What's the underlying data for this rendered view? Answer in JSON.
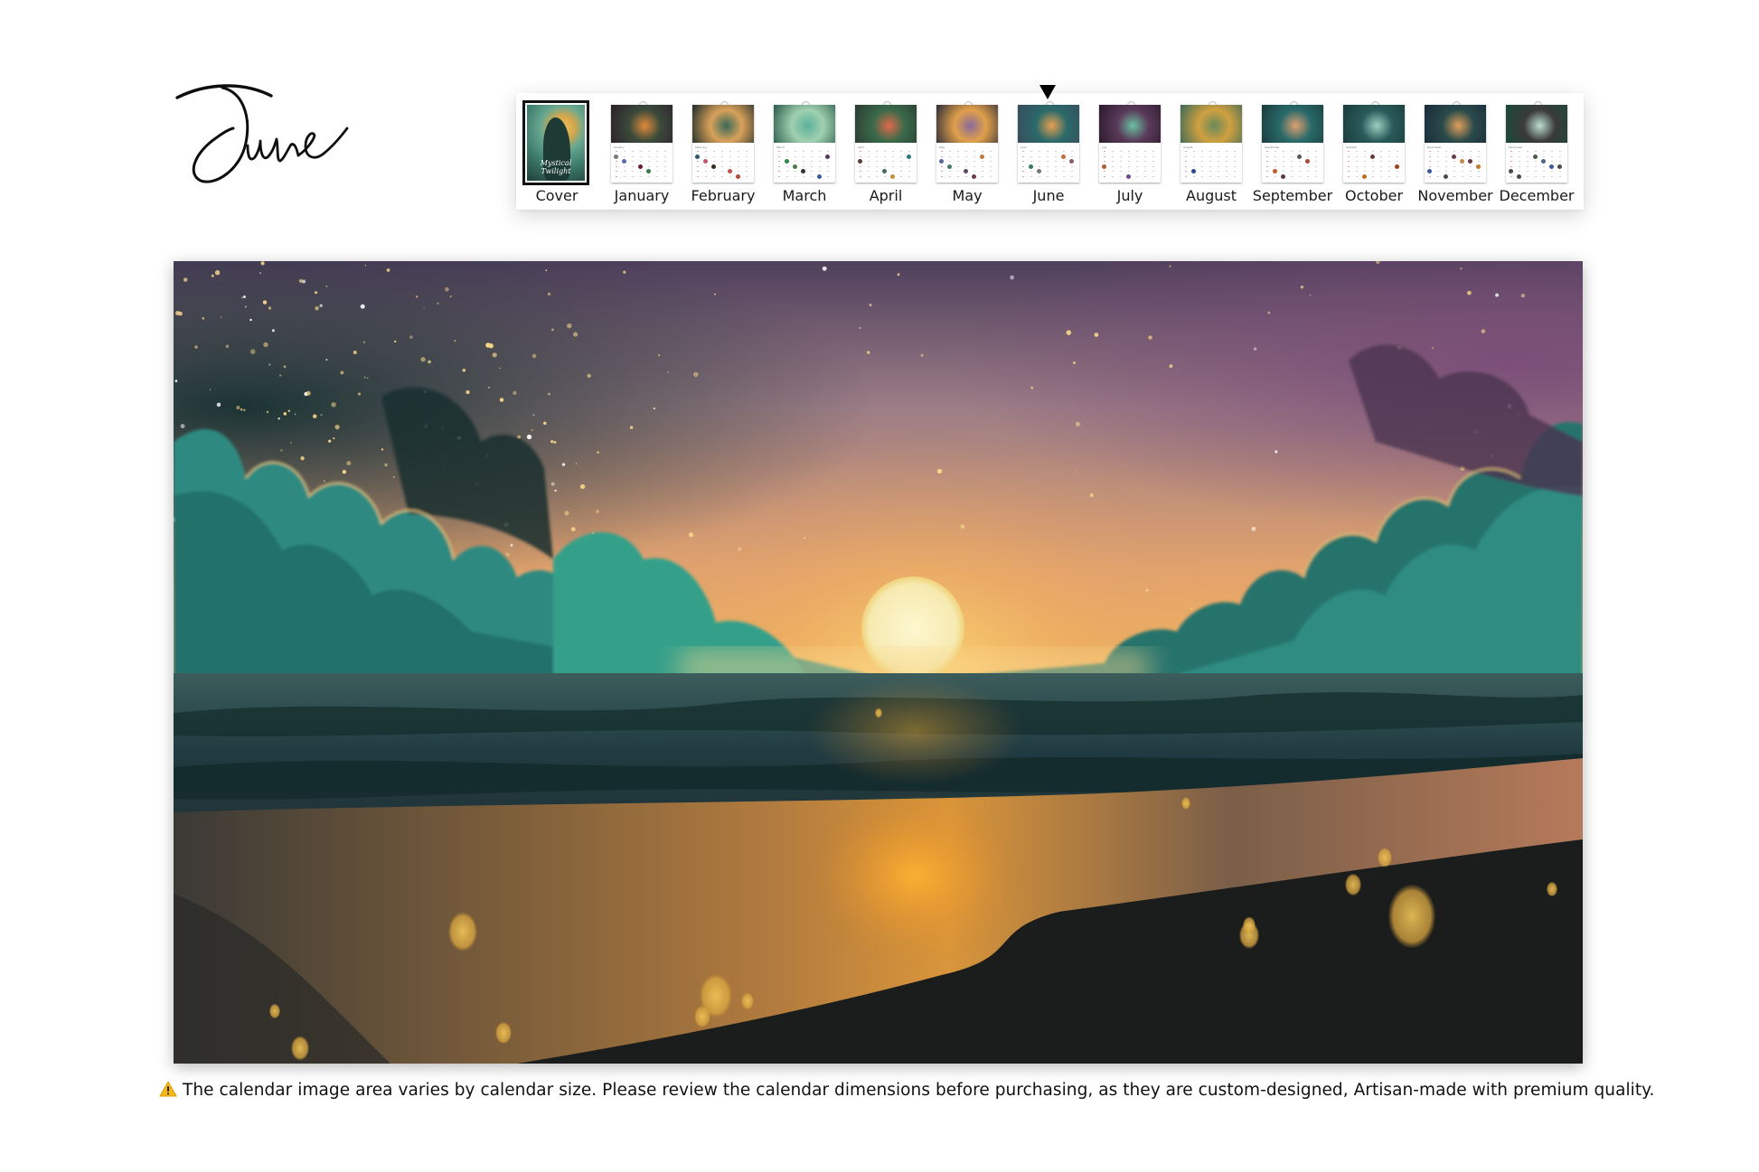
{
  "page": {
    "month_title": "June",
    "selected_month": "June"
  },
  "strip": {
    "items": [
      {
        "label": "Cover",
        "kind": "cover",
        "cover_text": "Mystical Twilight"
      },
      {
        "label": "January",
        "kind": "month",
        "colors": [
          "#2a1f2a",
          "#e08a3a",
          "#3b4a3a"
        ],
        "dots": [
          "#5a6ab0",
          "#3b7b4a",
          "#777777",
          "#6a1a3a"
        ]
      },
      {
        "label": "February",
        "kind": "month",
        "colors": [
          "#1b2a2a",
          "#3a6a5a",
          "#d9a15a"
        ],
        "dots": [
          "#3a2a1a",
          "#b04a3a",
          "#c05a6a",
          "#c0504a",
          "#2a5a6a"
        ]
      },
      {
        "label": "March",
        "kind": "month",
        "colors": [
          "#2a5a4a",
          "#5ab09a",
          "#a0d0b0"
        ],
        "dots": [
          "#333333",
          "#5a3a5a",
          "#4a7a4a",
          "#3a5aa0",
          "#2a8a4a"
        ]
      },
      {
        "label": "April",
        "kind": "month",
        "colors": [
          "#2a3a30",
          "#e06a4a",
          "#3a6a4a"
        ],
        "dots": [
          "#c0903a",
          "#5a3a3a",
          "#4a6a5a",
          "#2a7a7a"
        ]
      },
      {
        "label": "May",
        "kind": "month",
        "colors": [
          "#2a2a3a",
          "#8a6a9a",
          "#e0a04a"
        ],
        "dots": [
          "#c07a3a",
          "#4a7a5a",
          "#6a3a4a",
          "#5a6aa0",
          "#5a4a6a"
        ]
      },
      {
        "label": "June",
        "kind": "month",
        "colors": [
          "#3a4a5a",
          "#e8a050",
          "#2a6a6a"
        ],
        "dots": [
          "#8a5a6a",
          "#777777",
          "#c0703a",
          "#3a7a6a"
        ]
      },
      {
        "label": "July",
        "kind": "month",
        "colors": [
          "#2a1a2a",
          "#6ac0a0",
          "#5a3a5a"
        ],
        "dots": [
          "#b05a3a",
          "#6a4a8a"
        ]
      },
      {
        "label": "August",
        "kind": "month",
        "colors": [
          "#3a6a5a",
          "#6a8a5a",
          "#d0a040"
        ],
        "dots": [
          "#2a4a8a"
        ]
      },
      {
        "label": "September",
        "kind": "month",
        "colors": [
          "#1a3a3a",
          "#e0a070",
          "#2a6a6a"
        ],
        "dots": [
          "#5a3a4a",
          "#b04a3a",
          "#c05a2a",
          "#5a5a5a"
        ]
      },
      {
        "label": "October",
        "kind": "month",
        "colors": [
          "#1a3a3a",
          "#9ad0c0",
          "#2a5a5a"
        ],
        "dots": [
          "#6a3a3a",
          "#a0401a",
          "#c0701a"
        ]
      },
      {
        "label": "November",
        "kind": "month",
        "colors": [
          "#1a2a3a",
          "#e0a05a",
          "#2a4a4a"
        ],
        "dots": [
          "#c08a4a",
          "#3a5a9a",
          "#6a3a4a",
          "#c07a2a",
          "#4a4a4a",
          "#6a3a4a"
        ]
      },
      {
        "label": "December",
        "kind": "month",
        "colors": [
          "#1a4a3a",
          "#bde0d0",
          "#3a3a3a"
        ],
        "dots": [
          "#3a5a9a",
          "#4a4a4a",
          "#4a6a8a",
          "#4a4a4a",
          "#4a5a4a",
          "#4a4a4a"
        ]
      }
    ],
    "selected_index": 6
  },
  "hero": {
    "subject": "sunset over ocean beach with teal clouds and bokeh lights",
    "palette": {
      "sky_top": "#5a4a66",
      "sky_mid": "#c99a7a",
      "glow": "#f3b250",
      "sun": "#f8f0b8",
      "cloud_teal": "#2f8f84",
      "cloud_dark": "#1d3a3d",
      "sea": "#223a40",
      "sand_wet": "#8a6a4a",
      "sand_dark": "#1c1e1e",
      "bokeh": "#e8b54a"
    }
  },
  "notice": {
    "icon": "warning-icon",
    "text": "The calendar image area varies by calendar size. Please review the calendar dimensions before purchasing, as they are custom-designed, Artisan-made with premium quality."
  }
}
